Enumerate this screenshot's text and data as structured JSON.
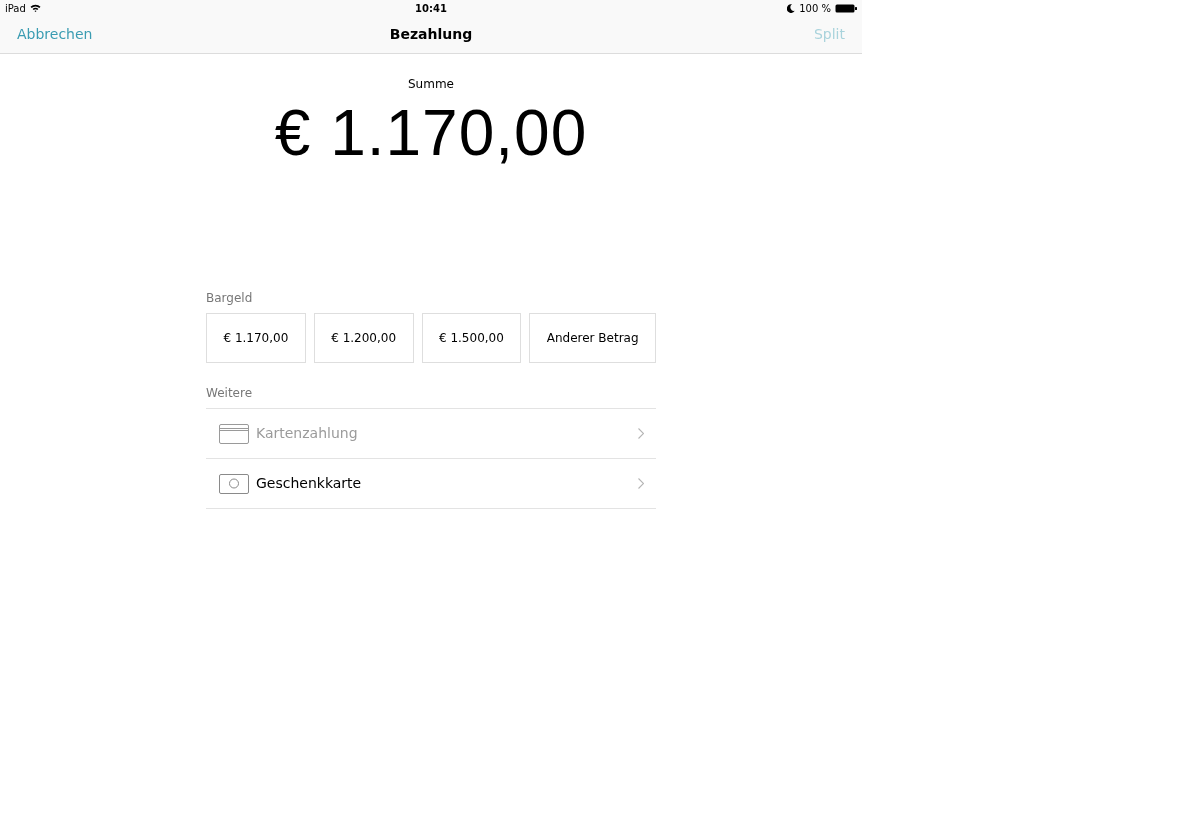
{
  "status_bar": {
    "device": "iPad",
    "time": "10:41",
    "battery": "100 %"
  },
  "nav_bar": {
    "cancel": {
      "label": "Abbrechen",
      "disabled": false
    },
    "title": "Bezahlung",
    "split": {
      "label": "Split",
      "disabled": true
    }
  },
  "total": {
    "label": "Summe",
    "amount": "€ 1.170,00"
  },
  "cash": {
    "label": "Bargeld",
    "options": [
      "€ 1.170,00",
      "€ 1.200,00",
      "€ 1.500,00",
      "Anderer Betrag"
    ]
  },
  "other": {
    "label": "Weitere",
    "methods": [
      {
        "kind": "card",
        "label": "Kartenzahlung",
        "disabled": true
      },
      {
        "kind": "gift_card",
        "label": "Geschenkkarte",
        "disabled": false
      }
    ]
  }
}
